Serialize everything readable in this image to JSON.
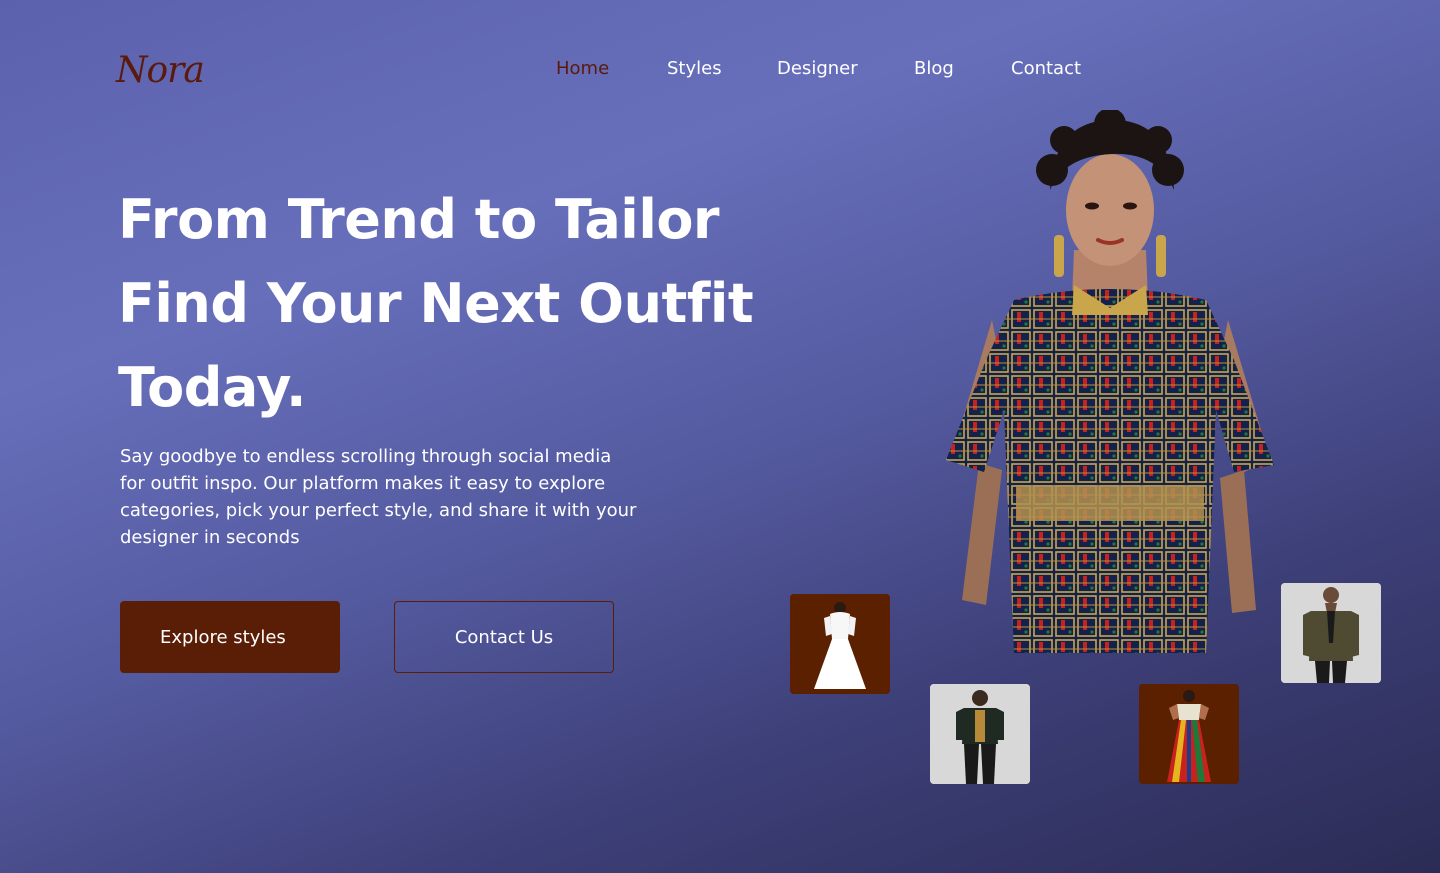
{
  "brand": {
    "logo_text": "Nora"
  },
  "nav": {
    "items": [
      {
        "label": "Home",
        "active": true
      },
      {
        "label": "Styles",
        "active": false
      },
      {
        "label": "Designer",
        "active": false
      },
      {
        "label": "Blog",
        "active": false
      },
      {
        "label": "Contact",
        "active": false
      }
    ]
  },
  "hero": {
    "title_lines": [
      "From Trend to Tailor",
      "Find Your Next Outfit",
      "Today."
    ],
    "description": "Say goodbye to endless scrolling through social media for outfit inspo. Our platform makes it easy to explore categories, pick your perfect style, and share it with your designer in seconds",
    "primary_button": "Explore styles",
    "secondary_button": "Contact Us"
  },
  "images": {
    "main": {
      "icon": "model-in-patterned-dress-image"
    },
    "thumbnails": [
      {
        "icon": "bridal-gown-image",
        "bg": "#5a2000"
      },
      {
        "icon": "man-in-embroidered-shirt-image",
        "bg": "#d8d8d8"
      },
      {
        "icon": "woman-in-kente-dress-image",
        "bg": "#5a2000"
      },
      {
        "icon": "man-in-blazer-image",
        "bg": "#d8d8d8"
      }
    ]
  },
  "colors": {
    "accent": "#5a1e06",
    "active_nav": "#5a1a0c",
    "background_start": "#5c61ad",
    "background_end": "#2b2c55"
  }
}
